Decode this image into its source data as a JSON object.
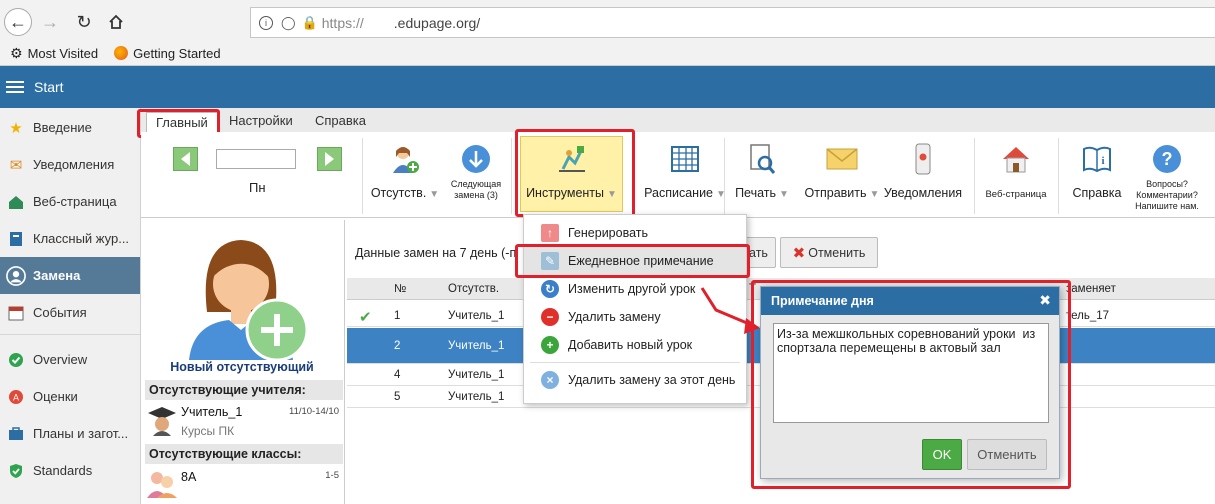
{
  "browser": {
    "url_proto": "https://",
    "url_host": ".edupage.org/",
    "bookmarks": [
      "Most Visited",
      "Getting Started"
    ]
  },
  "app": {
    "title": "Start"
  },
  "sidebar": {
    "items": [
      {
        "label": "Введение",
        "icon": "star-icon",
        "color": "#f0b400"
      },
      {
        "label": "Уведомления",
        "icon": "envelope-icon",
        "color": "#e08a1e"
      },
      {
        "label": "Веб-страница",
        "icon": "home-icon",
        "color": "#2e8b57"
      },
      {
        "label": "Классный жур...",
        "icon": "book-icon",
        "color": "#2c6ea4"
      },
      {
        "label": "Замена",
        "icon": "user-circle-icon",
        "color": "#ffffff"
      },
      {
        "label": "События",
        "icon": "calendar-icon",
        "color": "#c0392b"
      },
      {
        "label": "Overview",
        "icon": "check-circle-icon",
        "color": "#2ea44f"
      },
      {
        "label": "Оценки",
        "icon": "grade-icon",
        "color": "#e04a3a"
      },
      {
        "label": "Планы и загот...",
        "icon": "briefcase-icon",
        "color": "#2c6ea4"
      },
      {
        "label": "Standards",
        "icon": "shield-icon",
        "color": "#2ea44f"
      }
    ]
  },
  "ribbon": {
    "tabs": [
      "Главный",
      "Настройки",
      "Справка"
    ],
    "day_label": "Пн",
    "buttons": {
      "absent": "Отсутств.",
      "next_sub": "Следующая замена (3)",
      "tools": "Инструменты",
      "schedule": "Расписание",
      "print": "Печать",
      "send": "Отправить",
      "notify": "Уведомления",
      "website": "Веб-страница",
      "help": "Справка",
      "questions": "Вопросы? Комментарии? Напишите нам."
    }
  },
  "left_panel": {
    "new_absent": "Новый отсутствующий",
    "absent_teachers_header": "Отсутствующие учителя:",
    "teacher": {
      "name": "Учитель_1",
      "dates": "11/10-14/10",
      "note": "Курсы ПК"
    },
    "absent_classes_header": "Отсутствующие классы:",
    "klass": {
      "name": "8А",
      "periods": "1-5"
    }
  },
  "grid": {
    "title": "Данные замен на 7 день (-п",
    "print_label": "ать",
    "cancel_label": "Отменить",
    "columns": [
      "№",
      "Отсутств.",
      "Т",
      "заменяет"
    ],
    "rows": [
      {
        "n": "1",
        "teacher": "Учитель_1",
        "sub": "тель_17",
        "checked": true
      },
      {
        "n": "2",
        "teacher": "Учитель_1",
        "sub": "",
        "checked": false
      },
      {
        "n": "4",
        "teacher": "Учитель_1",
        "sub": "",
        "checked": false
      },
      {
        "n": "5",
        "teacher": "Учитель_1",
        "sub": "",
        "checked": false
      }
    ]
  },
  "menu": {
    "items": [
      {
        "label": "Генерировать",
        "icon": "generate-icon"
      },
      {
        "label": "Ежедневное примечание",
        "icon": "note-icon"
      },
      {
        "label": "Изменить другой урок",
        "icon": "refresh-icon"
      },
      {
        "label": "Удалить замену",
        "icon": "minus-circle-icon"
      },
      {
        "label": "Добавить новый урок",
        "icon": "plus-circle-icon"
      },
      {
        "label": "Удалить замену за этот день",
        "icon": "delete-day-icon"
      }
    ]
  },
  "dialog": {
    "title": "Примечание дня",
    "text": "Из-за межшкольных соревнований уроки  из спортзала перемещены в актовый зал",
    "ok": "OK",
    "cancel": "Отменить"
  },
  "colors": {
    "accent": "#2c6ea4",
    "highlight": "#e0202a",
    "ok": "#4caa45",
    "selected_row": "#3d83c3"
  }
}
